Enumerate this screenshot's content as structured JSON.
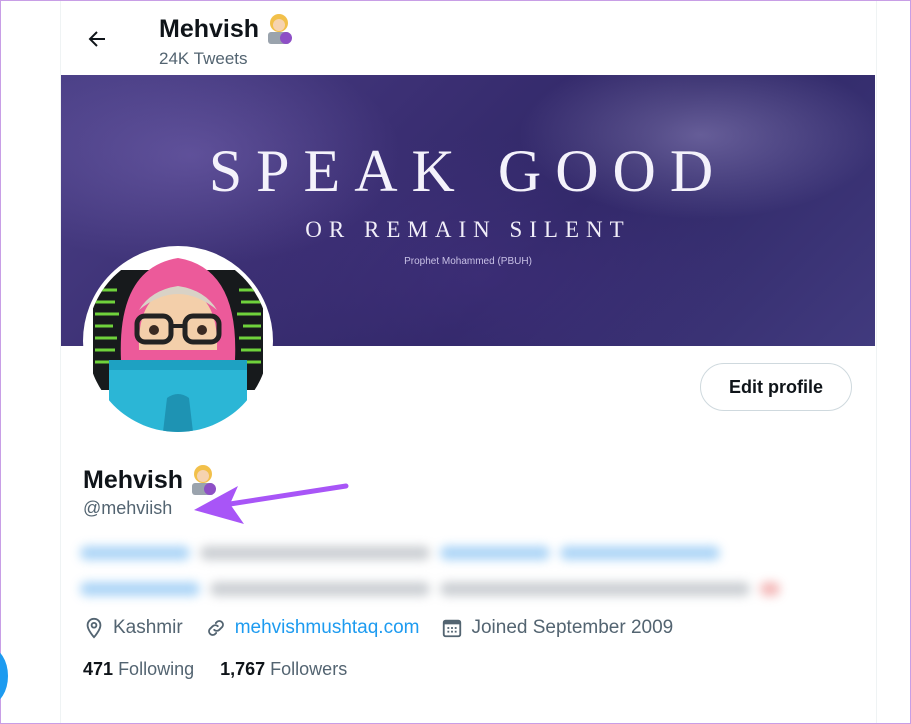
{
  "header": {
    "name": "Mehvish",
    "tweet_count": "24K Tweets"
  },
  "banner": {
    "title": "SPEAK GOOD",
    "subtitle": "OR REMAIN SILENT",
    "credit": "Prophet Mohammed (PBUH)"
  },
  "profile": {
    "display_name": "Mehvish",
    "handle": "@mehviish",
    "edit_label": "Edit profile",
    "location": "Kashmir",
    "website": "mehvishmushtaq.com",
    "joined": "Joined September 2009"
  },
  "stats": {
    "following_count": "471",
    "following_label": "Following",
    "followers_count": "1,767",
    "followers_label": "Followers"
  },
  "icons": {
    "back": "arrow-left-icon",
    "location": "location-pin-icon",
    "link": "link-icon",
    "calendar": "calendar-icon",
    "emoji": "woman-technologist-emoji"
  },
  "colors": {
    "accent": "#1d9bf0",
    "annotation_arrow": "#a855f7",
    "muted_text": "#536471"
  }
}
